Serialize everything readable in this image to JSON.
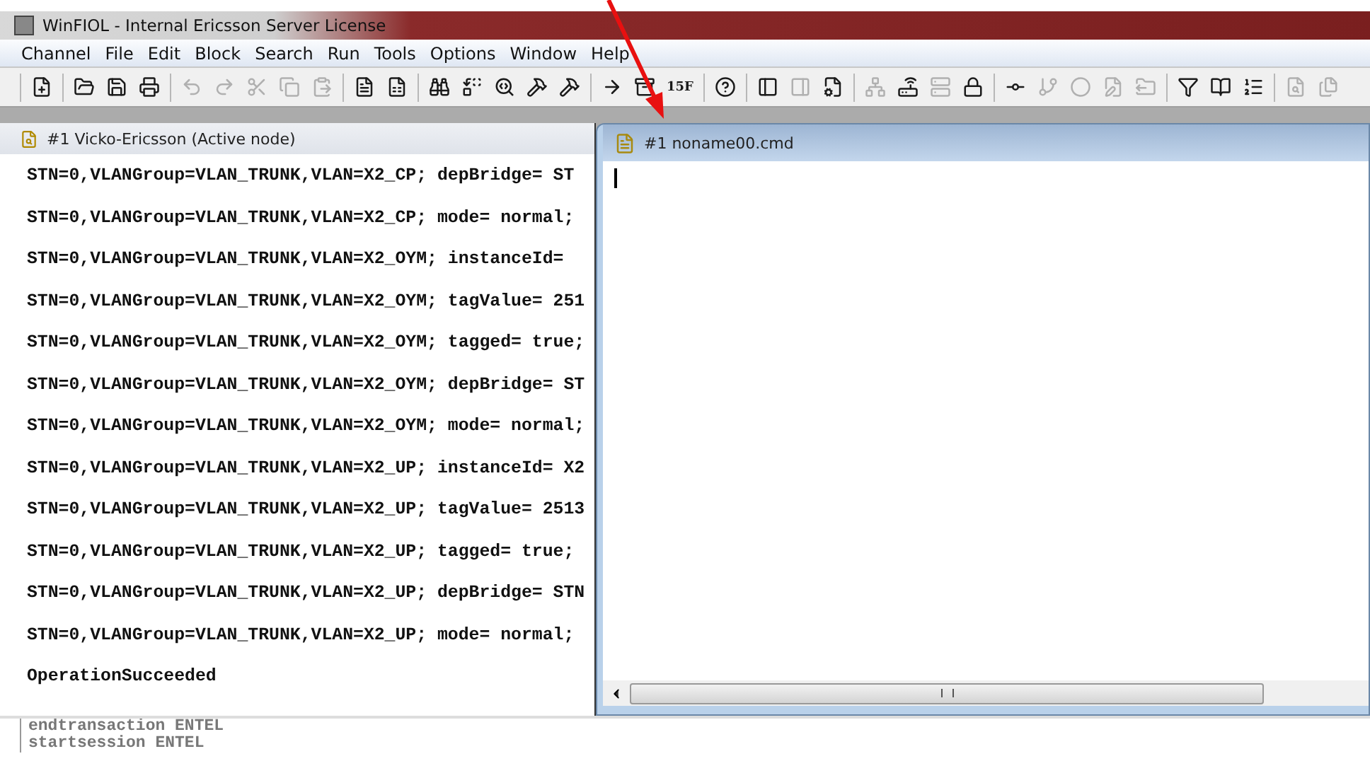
{
  "window": {
    "title": "WinFIOL - Internal Ericsson Server License"
  },
  "menu": [
    "Channel",
    "File",
    "Edit",
    "Block",
    "Search",
    "Run",
    "Tools",
    "Options",
    "Window",
    "Help"
  ],
  "toolbar": [
    [
      {
        "kind": "icon",
        "disabled": false
      }
    ],
    [
      {
        "kind": "icon",
        "disabled": false
      },
      {
        "kind": "icon",
        "disabled": false
      },
      {
        "kind": "icon",
        "disabled": false
      }
    ],
    [
      {
        "kind": "icon",
        "disabled": true
      },
      {
        "kind": "icon",
        "disabled": true
      },
      {
        "kind": "icon",
        "disabled": true
      },
      {
        "kind": "icon",
        "disabled": true
      },
      {
        "kind": "icon",
        "disabled": true
      }
    ],
    [
      {
        "kind": "icon",
        "disabled": false
      },
      {
        "kind": "icon",
        "disabled": false
      }
    ],
    [
      {
        "kind": "icon",
        "disabled": false
      },
      {
        "kind": "icon",
        "disabled": false
      },
      {
        "kind": "icon",
        "disabled": false
      },
      {
        "kind": "icon",
        "disabled": false
      },
      {
        "kind": "icon",
        "disabled": false
      }
    ],
    [
      {
        "kind": "icon",
        "disabled": false
      },
      {
        "kind": "icon",
        "disabled": false
      },
      {
        "kind": "label",
        "text": "15F",
        "disabled": false
      }
    ],
    [
      {
        "kind": "icon",
        "disabled": false
      }
    ],
    [
      {
        "kind": "icon",
        "disabled": false
      },
      {
        "kind": "icon",
        "disabled": true
      },
      {
        "kind": "icon",
        "disabled": false
      }
    ],
    [
      {
        "kind": "icon",
        "disabled": true
      },
      {
        "kind": "icon",
        "disabled": false
      },
      {
        "kind": "icon",
        "disabled": true
      },
      {
        "kind": "icon",
        "disabled": false
      }
    ],
    [
      {
        "kind": "icon",
        "disabled": false
      },
      {
        "kind": "icon",
        "disabled": true
      },
      {
        "kind": "icon",
        "disabled": true
      },
      {
        "kind": "icon",
        "disabled": true
      },
      {
        "kind": "icon",
        "disabled": true
      }
    ],
    [
      {
        "kind": "icon",
        "disabled": false
      },
      {
        "kind": "icon",
        "disabled": false
      },
      {
        "kind": "icon",
        "disabled": false
      }
    ],
    [
      {
        "kind": "icon",
        "disabled": true
      },
      {
        "kind": "icon",
        "disabled": true
      }
    ]
  ],
  "node_window": {
    "title": "#1 Vicko-Ericsson (Active node)",
    "lines": [
      "STN=0,VLANGroup=VLAN_TRUNK,VLAN=X2_CP; depBridge= ST",
      "STN=0,VLANGroup=VLAN_TRUNK,VLAN=X2_CP; mode= normal;",
      "STN=0,VLANGroup=VLAN_TRUNK,VLAN=X2_OYM; instanceId=",
      "STN=0,VLANGroup=VLAN_TRUNK,VLAN=X2_OYM; tagValue= 251",
      "STN=0,VLANGroup=VLAN_TRUNK,VLAN=X2_OYM; tagged= true;",
      "STN=0,VLANGroup=VLAN_TRUNK,VLAN=X2_OYM; depBridge= ST",
      "STN=0,VLANGroup=VLAN_TRUNK,VLAN=X2_OYM; mode= normal;",
      "STN=0,VLANGroup=VLAN_TRUNK,VLAN=X2_UP; instanceId= X2",
      "STN=0,VLANGroup=VLAN_TRUNK,VLAN=X2_UP; tagValue= 2513",
      "STN=0,VLANGroup=VLAN_TRUNK,VLAN=X2_UP; tagged= true;",
      "STN=0,VLANGroup=VLAN_TRUNK,VLAN=X2_UP; depBridge= STN",
      "STN=0,VLANGroup=VLAN_TRUNK,VLAN=X2_UP; mode= normal;",
      "OperationSucceeded"
    ]
  },
  "editor_window": {
    "title": "#1 noname00.cmd"
  },
  "log": [
    "endtransaction ENTEL",
    "startsession ENTEL"
  ]
}
